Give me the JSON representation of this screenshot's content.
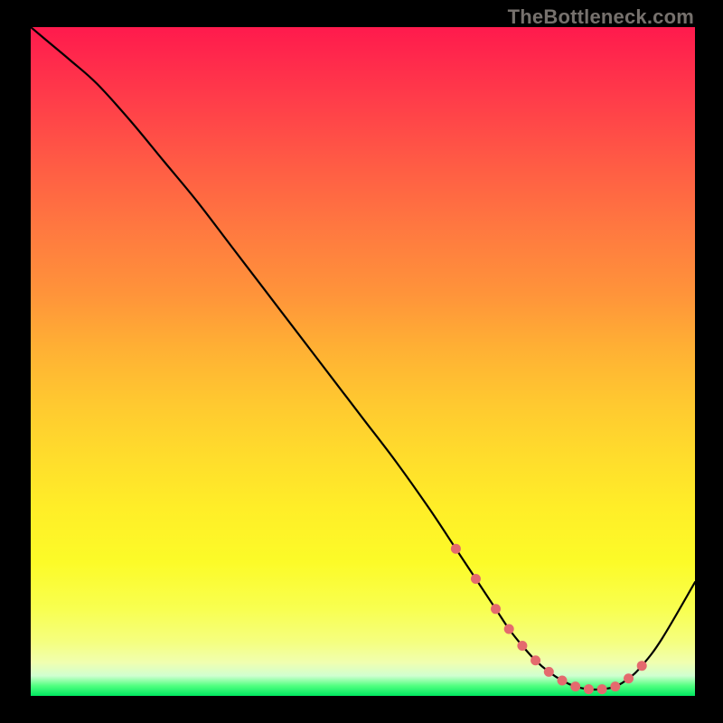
{
  "watermark": "TheBottleneck.com",
  "colors": {
    "curve": "#000000",
    "markers": "#e46a6e",
    "background": "#000000"
  },
  "chart_data": {
    "type": "line",
    "title": "",
    "xlabel": "",
    "ylabel": "",
    "xlim": [
      0,
      100
    ],
    "ylim": [
      0,
      100
    ],
    "grid": false,
    "legend": false,
    "x": [
      0,
      3,
      6,
      10,
      15,
      20,
      25,
      30,
      35,
      40,
      45,
      50,
      55,
      60,
      64,
      67,
      70,
      72,
      74,
      76,
      78,
      80,
      82,
      84,
      86,
      88,
      90,
      92,
      95,
      100
    ],
    "y": [
      100,
      97.5,
      95,
      91.5,
      86,
      80,
      74,
      67.5,
      61,
      54.5,
      48,
      41.5,
      35,
      28,
      22,
      17.5,
      13,
      10,
      7.5,
      5.3,
      3.6,
      2.3,
      1.4,
      1.0,
      1.0,
      1.4,
      2.6,
      4.5,
      8.5,
      17
    ],
    "markers_x": [
      64,
      67,
      70,
      72,
      74,
      76,
      78,
      80,
      82,
      84,
      86,
      88,
      90,
      92
    ],
    "markers_y": [
      22,
      17.5,
      13,
      10,
      7.5,
      5.3,
      3.6,
      2.3,
      1.4,
      1.0,
      1.0,
      1.4,
      2.6,
      4.5
    ]
  }
}
